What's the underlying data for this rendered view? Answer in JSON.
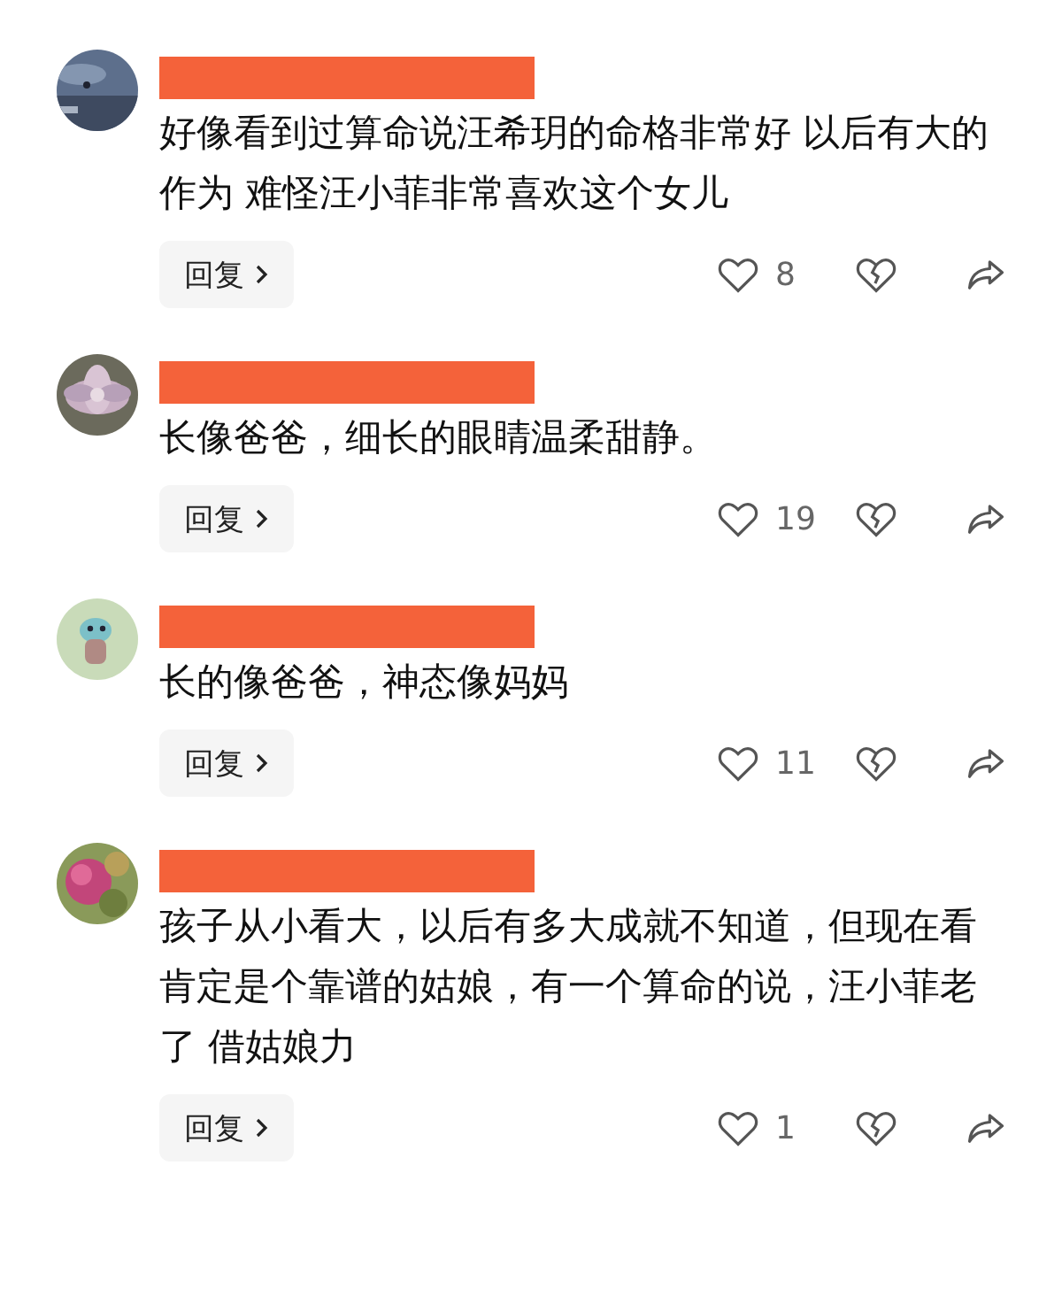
{
  "comments": [
    {
      "text": "好像看到过算命说汪希玥的命格非常好 以后有大的作为 难怪汪小菲非常喜欢这个女儿",
      "reply_label": "回复",
      "likes": "8"
    },
    {
      "text": "长像爸爸，细长的眼睛温柔甜静。",
      "reply_label": "回复",
      "likes": "19"
    },
    {
      "text": "长的像爸爸，神态像妈妈",
      "reply_label": "回复",
      "likes": "11"
    },
    {
      "text": "孩子从小看大，以后有多大成就不知道，但现在看肯定是个靠谱的姑娘，有一个算命的说，汪小菲老了 借姑娘力",
      "reply_label": "回复",
      "likes": "1"
    }
  ]
}
